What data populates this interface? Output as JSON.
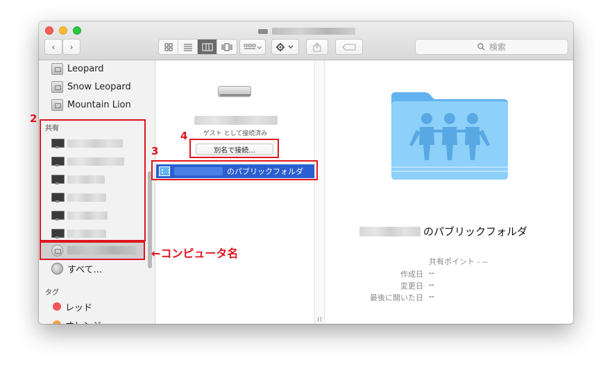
{
  "window": {
    "title_blur": ""
  },
  "toolbar": {
    "back_glyph": "‹",
    "forward_glyph": "›",
    "view_modes": [
      "icon-view-icon",
      "list-view-icon",
      "column-view-icon",
      "coverflow-view-icon"
    ],
    "search_placeholder": "検索"
  },
  "sidebar": {
    "devices": [
      "Leopard",
      "Snow Leopard",
      "Mountain Lion"
    ],
    "shared_header": "共有",
    "all_label": "すべて...",
    "tags_header": "タグ",
    "tags": [
      {
        "label": "レッド",
        "color": "#f25656"
      },
      {
        "label": "オレンジ",
        "color": "#f6a23b"
      }
    ]
  },
  "column": {
    "guest_text": "ゲスト として接続済み",
    "alias_button": "別名で接続...",
    "public_folder_suffix": "のパブリックフォルダ"
  },
  "preview": {
    "folder_name_suffix": "のパブリックフォルダ",
    "shared_point": "共有ポイント - --",
    "created_label": "作成日",
    "created_value": "--",
    "modified_label": "変更日",
    "modified_value": "--",
    "last_opened_label": "最後に開いた日",
    "last_opened_value": "--"
  },
  "annotations": {
    "label_2": "2",
    "label_3": "3",
    "label_4": "4",
    "computer_name": "←コンピュータ名"
  },
  "colors": {
    "annotation_red": "#e0141c",
    "selection_blue": "#2b5fd0",
    "folder_blue": "#7ec3f3"
  }
}
